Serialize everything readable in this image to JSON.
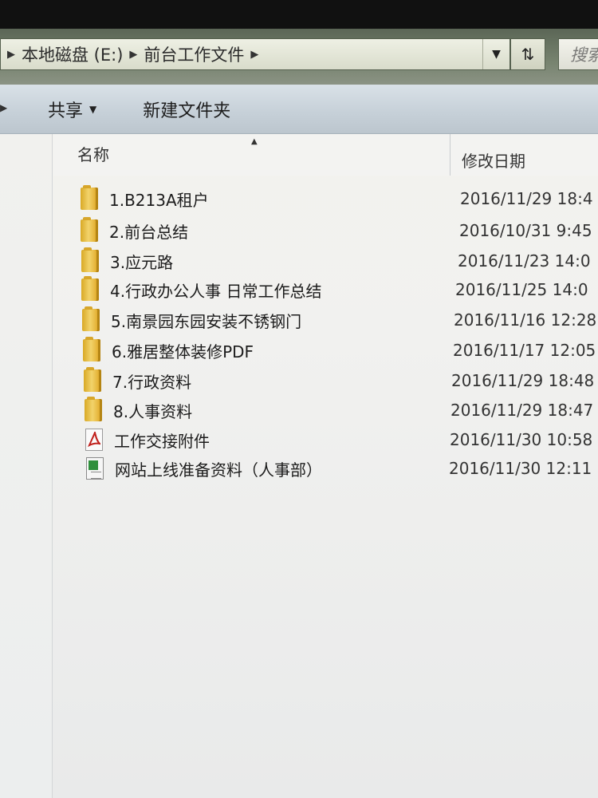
{
  "address_bar": {
    "breadcrumbs": [
      "本地磁盘 (E:)",
      "前台工作文件"
    ],
    "search_placeholder": "搜索"
  },
  "toolbar": {
    "share_label": "共享",
    "new_folder_label": "新建文件夹"
  },
  "columns": {
    "name": "名称",
    "date_modified": "修改日期"
  },
  "files": [
    {
      "name": "1.B213A租户",
      "type": "folder",
      "date": "2016/11/29 18:4"
    },
    {
      "name": "2.前台总结",
      "type": "folder",
      "date": "2016/10/31 9:45"
    },
    {
      "name": "3.应元路",
      "type": "folder",
      "date": "2016/11/23 14:0"
    },
    {
      "name": "4.行政办公人事 日常工作总结",
      "type": "folder",
      "date": "2016/11/25 14:0"
    },
    {
      "name": "5.南景园东园安装不锈钢门",
      "type": "folder",
      "date": "2016/11/16 12:28"
    },
    {
      "name": "6.雅居整体装修PDF",
      "type": "folder",
      "date": "2016/11/17 12:05"
    },
    {
      "name": "7.行政资料",
      "type": "folder",
      "date": "2016/11/29 18:48"
    },
    {
      "name": "8.人事资料",
      "type": "folder",
      "date": "2016/11/29 18:47"
    },
    {
      "name": "工作交接附件",
      "type": "pdf",
      "date": "2016/11/30 10:58"
    },
    {
      "name": "网站上线准备资料（人事部）",
      "type": "excel",
      "date": "2016/11/30 12:11"
    }
  ]
}
